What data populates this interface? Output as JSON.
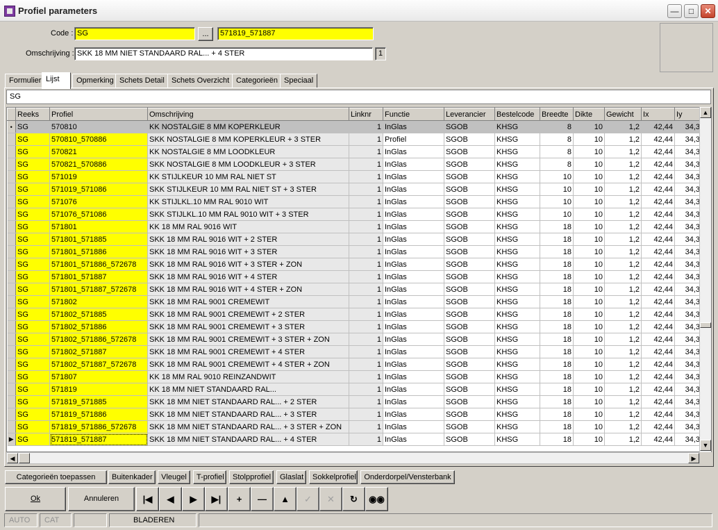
{
  "window": {
    "title": "Profiel parameters"
  },
  "header": {
    "code_label": "Code :",
    "code_value": "SG",
    "browse_label": "...",
    "code_description": "571819_571887",
    "omschrijving_label": "Omschrijving :",
    "omschrijving_value": "SKK 18 MM NIET STANDAARD RAL... + 4 STER",
    "count": "1"
  },
  "tabs": [
    "Formulier",
    "Lijst",
    "Opmerking",
    "Schets Detail",
    "Schets Overzicht",
    "Categorieën",
    "Speciaal"
  ],
  "active_tab": "Lijst",
  "filter_value": "SG",
  "grid": {
    "columns": [
      "Reeks",
      "Profiel",
      "Omschrijving",
      "Linknr",
      "Functie",
      "Leverancier",
      "Bestelcode",
      "Breedte",
      "Dikte",
      "Gewicht",
      "Ix",
      "Iy"
    ],
    "rows": [
      [
        "SG",
        "570810",
        "KK NOSTALGIE 8 MM KOPERKLEUR",
        "1",
        "InGlas",
        "SGOB",
        "KHSG",
        "8",
        "10",
        "1,2",
        "42,44",
        "34,3"
      ],
      [
        "SG",
        "570810_570886",
        "SKK NOSTALGIE 8 MM KOPERKLEUR + 3 STER",
        "1",
        "Profiel",
        "SGOB",
        "KHSG",
        "8",
        "10",
        "1,2",
        "42,44",
        "34,3"
      ],
      [
        "SG",
        "570821",
        "KK NOSTALGIE 8 MM LOODKLEUR",
        "1",
        "InGlas",
        "SGOB",
        "KHSG",
        "8",
        "10",
        "1,2",
        "42,44",
        "34,3"
      ],
      [
        "SG",
        "570821_570886",
        "SKK NOSTALGIE 8 MM LOODKLEUR + 3 STER",
        "1",
        "InGlas",
        "SGOB",
        "KHSG",
        "8",
        "10",
        "1,2",
        "42,44",
        "34,3"
      ],
      [
        "SG",
        "571019",
        "KK STIJLKEUR 10 MM RAL NIET ST",
        "1",
        "InGlas",
        "SGOB",
        "KHSG",
        "10",
        "10",
        "1,2",
        "42,44",
        "34,3"
      ],
      [
        "SG",
        "571019_571086",
        "SKK STIJLKEUR 10 MM RAL NIET ST + 3 STER",
        "1",
        "InGlas",
        "SGOB",
        "KHSG",
        "10",
        "10",
        "1,2",
        "42,44",
        "34,3"
      ],
      [
        "SG",
        "571076",
        "KK STIJLKL.10 MM RAL 9010 WIT",
        "1",
        "InGlas",
        "SGOB",
        "KHSG",
        "10",
        "10",
        "1,2",
        "42,44",
        "34,3"
      ],
      [
        "SG",
        "571076_571086",
        "SKK STIJLKL.10 MM RAL 9010 WIT + 3 STER",
        "1",
        "InGlas",
        "SGOB",
        "KHSG",
        "10",
        "10",
        "1,2",
        "42,44",
        "34,3"
      ],
      [
        "SG",
        "571801",
        "KK 18 MM RAL 9016 WIT",
        "1",
        "InGlas",
        "SGOB",
        "KHSG",
        "18",
        "10",
        "1,2",
        "42,44",
        "34,3"
      ],
      [
        "SG",
        "571801_571885",
        "SKK 18 MM RAL 9016 WIT + 2 STER",
        "1",
        "InGlas",
        "SGOB",
        "KHSG",
        "18",
        "10",
        "1,2",
        "42,44",
        "34,3"
      ],
      [
        "SG",
        "571801_571886",
        "SKK 18 MM RAL 9016 WIT + 3 STER",
        "1",
        "InGlas",
        "SGOB",
        "KHSG",
        "18",
        "10",
        "1,2",
        "42,44",
        "34,3"
      ],
      [
        "SG",
        "571801_571886_572678",
        "SKK 18 MM RAL 9016 WIT + 3 STER + ZON",
        "1",
        "InGlas",
        "SGOB",
        "KHSG",
        "18",
        "10",
        "1,2",
        "42,44",
        "34,3"
      ],
      [
        "SG",
        "571801_571887",
        "SKK 18 MM RAL 9016 WIT + 4 STER",
        "1",
        "InGlas",
        "SGOB",
        "KHSG",
        "18",
        "10",
        "1,2",
        "42,44",
        "34,3"
      ],
      [
        "SG",
        "571801_571887_572678",
        "SKK 18 MM RAL 9016 WIT + 4 STER + ZON",
        "1",
        "InGlas",
        "SGOB",
        "KHSG",
        "18",
        "10",
        "1,2",
        "42,44",
        "34,3"
      ],
      [
        "SG",
        "571802",
        "SKK 18 MM RAL 9001 CREMEWIT",
        "1",
        "InGlas",
        "SGOB",
        "KHSG",
        "18",
        "10",
        "1,2",
        "42,44",
        "34,3"
      ],
      [
        "SG",
        "571802_571885",
        "SKK 18 MM RAL 9001 CREMEWIT + 2 STER",
        "1",
        "InGlas",
        "SGOB",
        "KHSG",
        "18",
        "10",
        "1,2",
        "42,44",
        "34,3"
      ],
      [
        "SG",
        "571802_571886",
        "SKK 18 MM RAL 9001 CREMEWIT + 3 STER",
        "1",
        "InGlas",
        "SGOB",
        "KHSG",
        "18",
        "10",
        "1,2",
        "42,44",
        "34,3"
      ],
      [
        "SG",
        "571802_571886_572678",
        "SKK 18 MM RAL 9001 CREMEWIT + 3 STER + ZON",
        "1",
        "InGlas",
        "SGOB",
        "KHSG",
        "18",
        "10",
        "1,2",
        "42,44",
        "34,3"
      ],
      [
        "SG",
        "571802_571887",
        "SKK 18 MM RAL 9001 CREMEWIT + 4 STER",
        "1",
        "InGlas",
        "SGOB",
        "KHSG",
        "18",
        "10",
        "1,2",
        "42,44",
        "34,3"
      ],
      [
        "SG",
        "571802_571887_572678",
        "SKK 18 MM RAL 9001 CREMEWIT + 4 STER + ZON",
        "1",
        "InGlas",
        "SGOB",
        "KHSG",
        "18",
        "10",
        "1,2",
        "42,44",
        "34,3"
      ],
      [
        "SG",
        "571807",
        "KK 18 MM RAL 9010 REINZANDWIT",
        "1",
        "InGlas",
        "SGOB",
        "KHSG",
        "18",
        "10",
        "1,2",
        "42,44",
        "34,3"
      ],
      [
        "SG",
        "571819",
        "KK 18 MM NIET STANDAARD RAL...",
        "1",
        "InGlas",
        "SGOB",
        "KHSG",
        "18",
        "10",
        "1,2",
        "42,44",
        "34,3"
      ],
      [
        "SG",
        "571819_571885",
        "SKK 18 MM NIET STANDAARD RAL... + 2 STER",
        "1",
        "InGlas",
        "SGOB",
        "KHSG",
        "18",
        "10",
        "1,2",
        "42,44",
        "34,3"
      ],
      [
        "SG",
        "571819_571886",
        "SKK 18 MM NIET STANDAARD RAL... + 3 STER",
        "1",
        "InGlas",
        "SGOB",
        "KHSG",
        "18",
        "10",
        "1,2",
        "42,44",
        "34,3"
      ],
      [
        "SG",
        "571819_571886_572678",
        "SKK 18 MM NIET STANDAARD RAL... + 3 STER + ZON",
        "1",
        "InGlas",
        "SGOB",
        "KHSG",
        "18",
        "10",
        "1,2",
        "42,44",
        "34,3"
      ],
      [
        "SG",
        "571819_571887",
        "SKK 18 MM NIET STANDAARD RAL... + 4 STER",
        "1",
        "InGlas",
        "SGOB",
        "KHSG",
        "18",
        "10",
        "1,2",
        "42,44",
        "34,3"
      ]
    ]
  },
  "category_buttons": [
    "Categorieën toepassen",
    "Buitenkader",
    "Vleugel",
    "T-profiel",
    "Stolpprofiel",
    "Glaslat",
    "Sokkelprofiel",
    "Onderdorpel/Vensterbank"
  ],
  "actions": {
    "ok_label": "Ok",
    "cancel_label": "Annuleren"
  },
  "navigator": [
    "first-icon",
    "prior-icon",
    "next-icon",
    "last-icon",
    "insert-icon",
    "delete-icon",
    "edit-icon",
    "post-icon",
    "cancel-icon",
    "refresh-icon",
    "search-icon"
  ],
  "status": {
    "auto": "AUTO",
    "cat": "CAT",
    "empty": "",
    "mode": "BLADEREN"
  },
  "colors": {
    "highlight_yellow": "#ffff00",
    "window_bg": "#d4d0c8"
  }
}
